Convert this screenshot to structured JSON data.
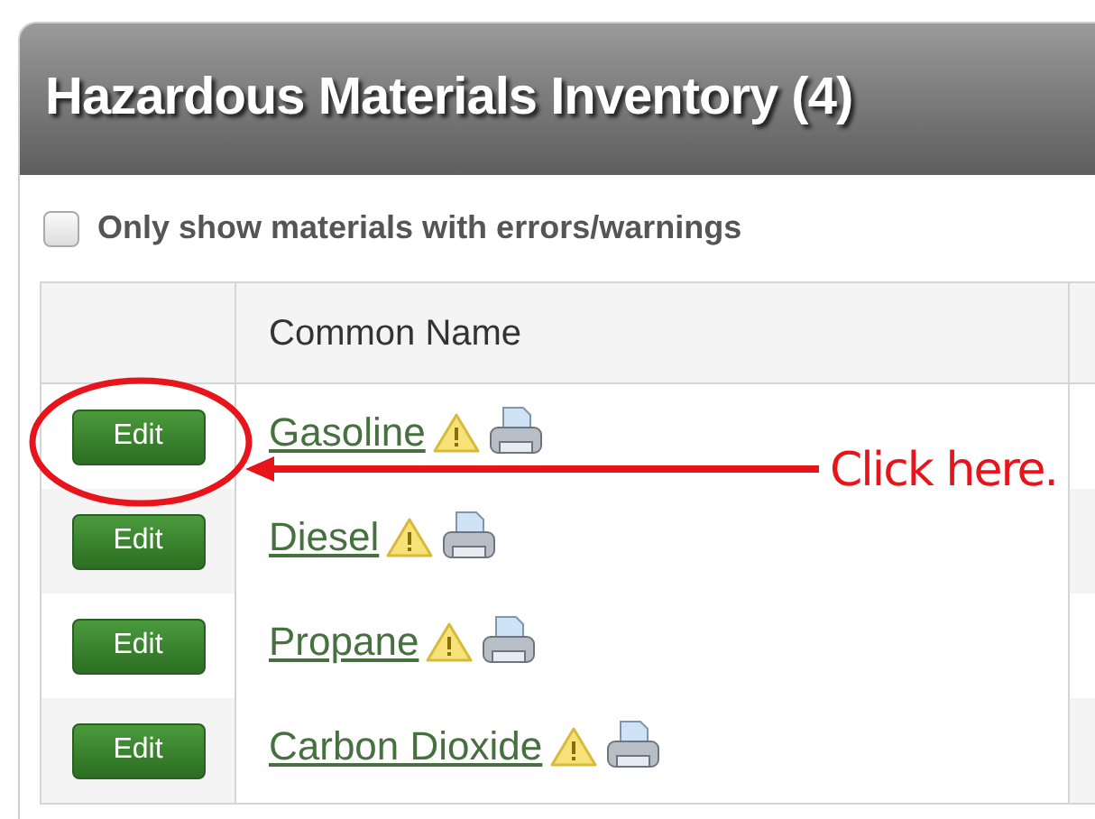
{
  "panel": {
    "title": "Hazardous Materials Inventory (4)"
  },
  "filter": {
    "label": "Only show materials with errors/warnings",
    "checked": false
  },
  "table": {
    "columns": [
      "Common Name"
    ],
    "rows": [
      {
        "action": "Edit",
        "name": "Gasoline"
      },
      {
        "action": "Edit",
        "name": "Diesel"
      },
      {
        "action": "Edit",
        "name": "Propane"
      },
      {
        "action": "Edit",
        "name": "Carbon Dioxide"
      }
    ]
  },
  "annotation": {
    "text": "Click here."
  }
}
